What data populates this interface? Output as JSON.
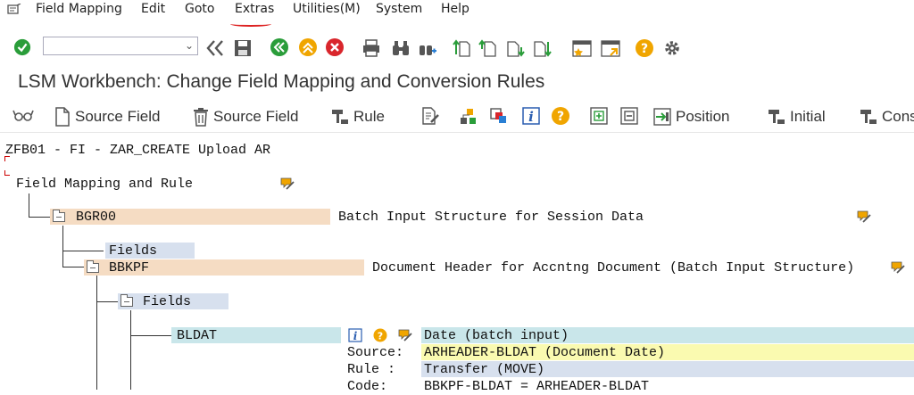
{
  "menu": [
    "Field Mapping",
    "Edit",
    "Goto",
    "Extras",
    "Utilities(M)",
    "System",
    "Help"
  ],
  "window_title": "LSM Workbench: Change Field Mapping and Conversion Rules",
  "toolbar": {
    "btn_source_field_create": "Source Field",
    "btn_source_field_delete": "Source Field",
    "btn_rule": "Rule",
    "btn_position": "Position",
    "btn_initial": "Initial",
    "btn_constant": "Cons"
  },
  "tree": {
    "header": "ZFB01 - FI - ZAR_CREATE Upload AR",
    "root": "Field Mapping and Rule",
    "nodes": [
      {
        "name": "BGR00",
        "desc": "Batch Input Structure for Session Data"
      },
      {
        "name": "BBKPF",
        "desc": "Document Header for Accntng Document (Batch Input Structure)"
      }
    ],
    "fields_label": "Fields",
    "field": {
      "name": "BLDAT",
      "desc": "Date (batch input)",
      "source_label": "Source:",
      "source_value": "ARHEADER-BLDAT (Document Date)",
      "rule_label": "Rule :",
      "rule_value": "Transfer (MOVE)",
      "code_label": "Code:",
      "code_value": "BBKPF-BLDAT = ARHEADER-BLDAT"
    }
  }
}
